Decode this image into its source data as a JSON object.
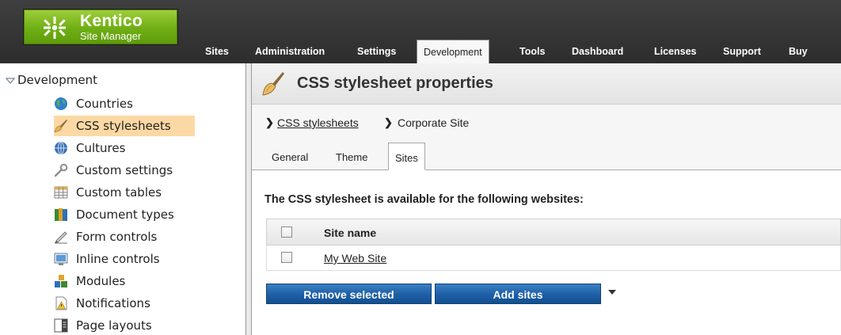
{
  "app": {
    "brand": "Kentico",
    "subtitle": "Site Manager"
  },
  "topnav": {
    "tabs": [
      {
        "label": "Sites"
      },
      {
        "label": "Administration"
      },
      {
        "label": "Settings"
      },
      {
        "label": "Development"
      },
      {
        "label": "Tools"
      },
      {
        "label": "Dashboard"
      },
      {
        "label": "Licenses"
      },
      {
        "label": "Support"
      },
      {
        "label": "Buy"
      }
    ],
    "active": "Development"
  },
  "tree": {
    "root": "Development",
    "items": [
      {
        "label": "Countries",
        "icon": "globe-icon"
      },
      {
        "label": "CSS stylesheets",
        "icon": "brush-icon"
      },
      {
        "label": "Cultures",
        "icon": "culture-globe-icon"
      },
      {
        "label": "Custom settings",
        "icon": "wrench-icon"
      },
      {
        "label": "Custom tables",
        "icon": "table-icon"
      },
      {
        "label": "Document types",
        "icon": "book-icon"
      },
      {
        "label": "Form controls",
        "icon": "pen-icon"
      },
      {
        "label": "Inline controls",
        "icon": "monitor-icon"
      },
      {
        "label": "Modules",
        "icon": "modules-icon"
      },
      {
        "label": "Notifications",
        "icon": "notification-icon"
      },
      {
        "label": "Page layouts",
        "icon": "page-layout-icon"
      }
    ],
    "selected": "CSS stylesheets"
  },
  "page": {
    "title": "CSS stylesheet properties",
    "breadcrumb": {
      "link": "CSS stylesheets",
      "current": "Corporate Site"
    },
    "tabs": [
      {
        "label": "General"
      },
      {
        "label": "Theme"
      },
      {
        "label": "Sites"
      }
    ],
    "active_tab": "Sites",
    "heading": "The CSS stylesheet is available for the following websites:",
    "grid": {
      "column": "Site name",
      "rows": [
        {
          "site": "My Web Site"
        }
      ]
    },
    "buttons": {
      "remove": "Remove selected",
      "add": "Add sites"
    }
  },
  "colors": {
    "header_bg": "#353536",
    "logo_green": "#7cbf1e",
    "selected_item": "#fcd9a4",
    "button_blue": "#1d5ea6"
  }
}
